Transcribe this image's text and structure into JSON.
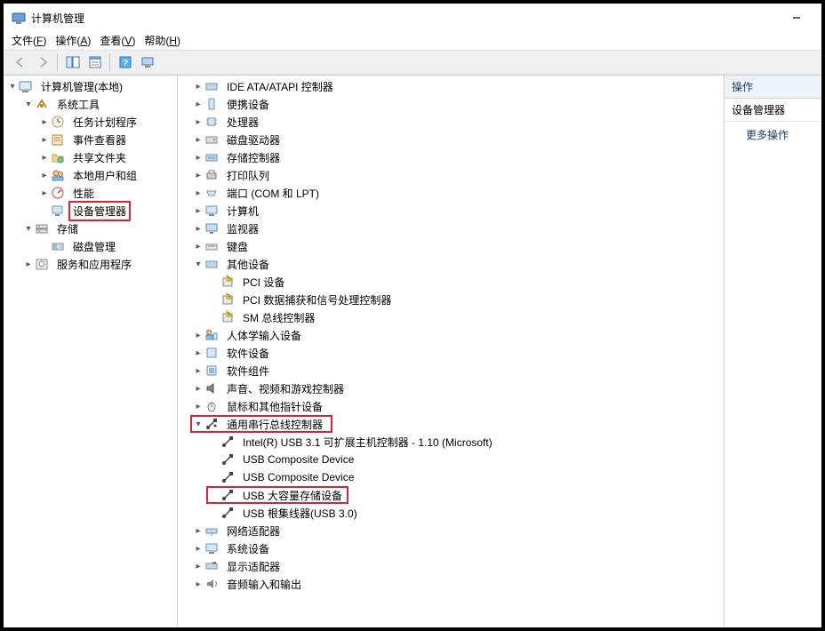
{
  "title": "计算机管理",
  "menus": {
    "file": "文件(F)",
    "action": "操作(A)",
    "view": "查看(V)",
    "help": "帮助(H)"
  },
  "left_tree": {
    "root": "计算机管理(本地)",
    "sys_tools": "系统工具",
    "task_sched": "任务计划程序",
    "event_viewer": "事件查看器",
    "shared_folders": "共享文件夹",
    "local_users": "本地用户和组",
    "performance": "性能",
    "device_manager": "设备管理器",
    "storage": "存储",
    "disk_mgmt": "磁盘管理",
    "services_apps": "服务和应用程序"
  },
  "center_tree": {
    "ide": "IDE ATA/ATAPI 控制器",
    "portable": "便携设备",
    "cpu": "处理器",
    "disk_drives": "磁盘驱动器",
    "storage_ctrl": "存储控制器",
    "print_queues": "打印队列",
    "ports": "端口 (COM 和 LPT)",
    "computer": "计算机",
    "monitor": "监视器",
    "keyboard": "键盘",
    "other_devices": "其他设备",
    "other_pci": "PCI 设备",
    "other_capt": "PCI 数据捕获和信号处理控制器",
    "other_sm": "SM 总线控制器",
    "hid": "人体学输入设备",
    "software_dev": "软件设备",
    "software_comp": "软件组件",
    "sound": "声音、视频和游戏控制器",
    "mouse": "鼠标和其他指针设备",
    "usb_ctrl": "通用串行总线控制器",
    "usb_intel": "Intel(R) USB 3.1 可扩展主机控制器 - 1.10 (Microsoft)",
    "usb_comp1": "USB Composite Device",
    "usb_comp2": "USB Composite Device",
    "usb_mass": "USB 大容量存储设备",
    "usb_root": "USB 根集线器(USB 3.0)",
    "network": "网络适配器",
    "system_dev": "系统设备",
    "display": "显示适配器",
    "audio_io": "音频输入和输出"
  },
  "actions": {
    "header": "操作",
    "selected": "设备管理器",
    "more": "更多操作"
  }
}
